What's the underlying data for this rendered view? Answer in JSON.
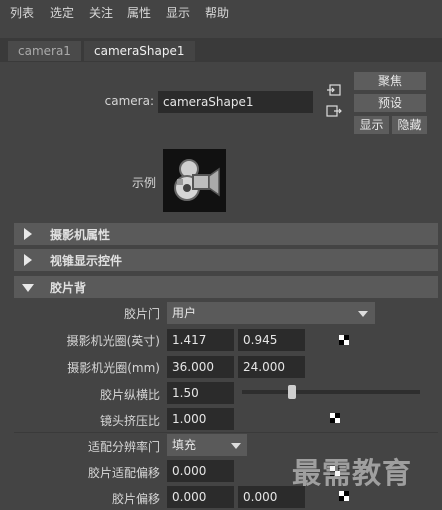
{
  "menu": [
    "列表",
    "选定",
    "关注",
    "属性",
    "显示",
    "帮助"
  ],
  "tabs": [
    "camera1",
    "cameraShape1"
  ],
  "camera": {
    "label": "camera:",
    "value": "cameraShape1"
  },
  "buttons": {
    "focus": "聚焦",
    "preset": "预设",
    "show": "显示",
    "hide": "隐藏"
  },
  "sample_label": "示例",
  "sections": [
    {
      "title": "摄影机属性",
      "expanded": false
    },
    {
      "title": "视锥显示控件",
      "expanded": false
    },
    {
      "title": "胶片背",
      "expanded": true
    }
  ],
  "film_back": {
    "film_gate": {
      "label": "胶片门",
      "value": "用户"
    },
    "aperture_in": {
      "label": "摄影机光圈(英寸)",
      "v1": "1.417",
      "v2": "0.945"
    },
    "aperture_mm": {
      "label": "摄影机光圈(mm)",
      "v1": "36.000",
      "v2": "24.000"
    },
    "aspect": {
      "label": "胶片纵横比",
      "value": "1.50",
      "slider_fraction": 0.28
    },
    "squeeze": {
      "label": "镜头挤压比",
      "value": "1.000"
    },
    "fit_gate": {
      "label": "适配分辨率门",
      "value": "填充"
    },
    "fit_offset": {
      "label": "胶片适配偏移",
      "value": "0.000"
    },
    "film_offset": {
      "label": "胶片偏移",
      "v1": "0.000",
      "v2": "0.000"
    }
  },
  "watermark": "最需教育",
  "colors": {
    "bg": "#444444",
    "field": "#2b2b2b",
    "section": "#5a5a5a",
    "button": "#5d5d5d"
  }
}
